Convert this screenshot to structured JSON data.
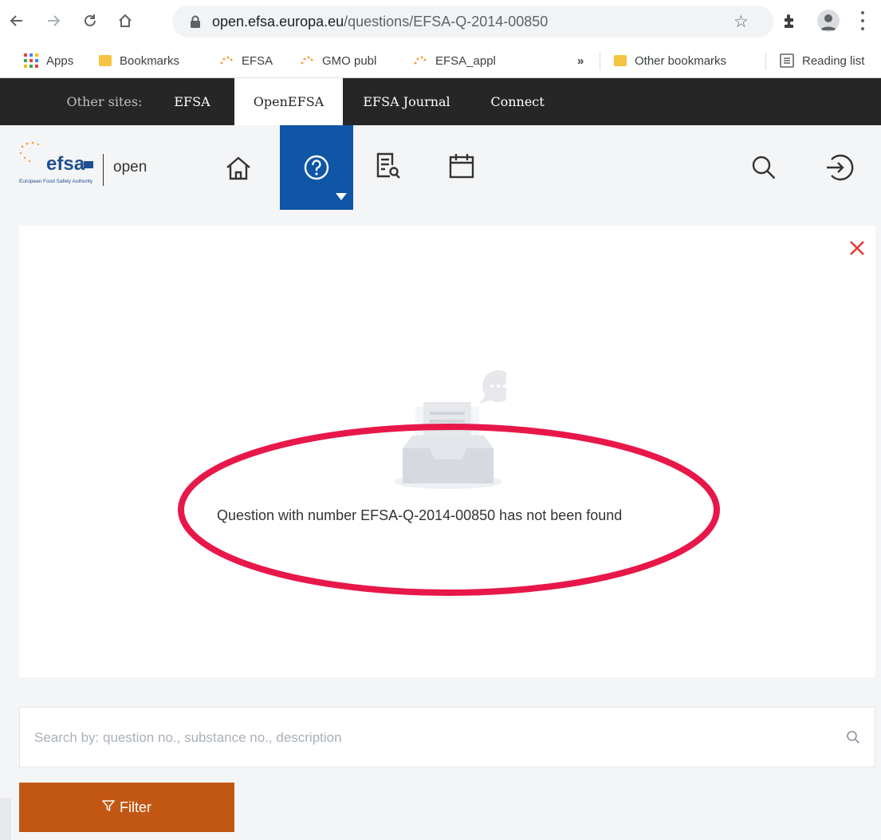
{
  "browser": {
    "url_host": "open.efsa.europa.eu",
    "url_path": "/questions/EFSA-Q-2014-00850",
    "bookmarks": [
      {
        "label": "Apps"
      },
      {
        "label": "Bookmarks"
      },
      {
        "label": "EFSA"
      },
      {
        "label": "GMO publ"
      },
      {
        "label": "EFSA_appl"
      }
    ],
    "overflow": "»",
    "other_bookmarks": "Other bookmarks",
    "reading_list": "Reading list"
  },
  "sites_bar": {
    "label": "Other sites:",
    "tabs": [
      {
        "label": "EFSA"
      },
      {
        "label": "OpenEFSA"
      },
      {
        "label": "EFSA Journal"
      },
      {
        "label": "Connect"
      }
    ]
  },
  "header": {
    "logo_text": "efsa",
    "logo_subtext": "European Food Safety Authority",
    "open_label": "open"
  },
  "main": {
    "not_found_message": "Question with number EFSA-Q-2014-00850 has not been found",
    "search_placeholder": "Search by: question no., substance no., description",
    "filter_label": "Filter"
  },
  "colors": {
    "accent_blue": "#0f56a7",
    "filter_orange": "#c25713",
    "close_red": "#e53935",
    "annotation_red": "#e8174a"
  }
}
